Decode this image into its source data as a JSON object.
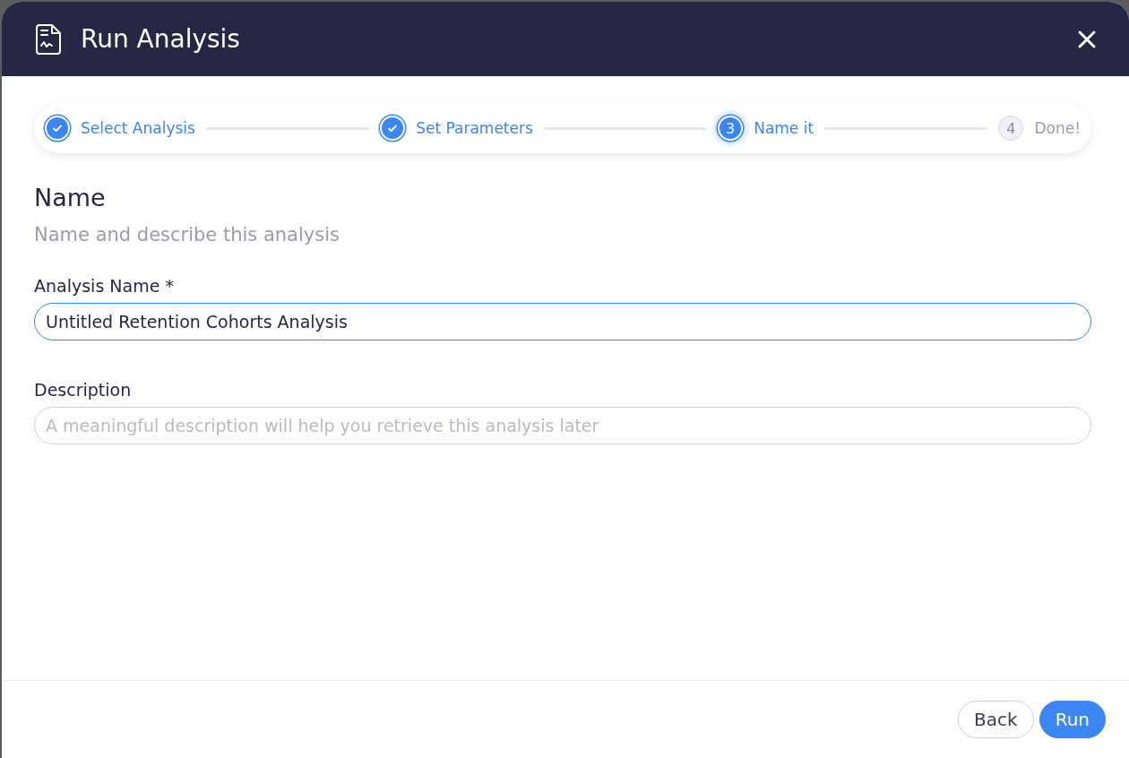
{
  "dialog": {
    "title": "Run Analysis"
  },
  "steps": [
    {
      "label": "Select Analysis",
      "done": true,
      "selected": false
    },
    {
      "label": "Set Parameters",
      "done": true,
      "selected": false
    },
    {
      "label": "Name it",
      "number": "3",
      "done": false,
      "selected": true
    },
    {
      "label": "Done!",
      "number": "4",
      "done": false,
      "selected": false
    }
  ],
  "section": {
    "heading": "Name",
    "subtitle": "Name and describe this analysis"
  },
  "fields": [
    {
      "label": "Analysis Name *",
      "value": "Untitled Retention Cohorts Analysis",
      "focused": true
    },
    {
      "label": "Description",
      "placeholder": "A meaningful description will help you retrieve this analysis later",
      "focused": false
    }
  ],
  "buttons": [
    {
      "label": "Back",
      "kind": "secondary"
    },
    {
      "label": "Run",
      "kind": "primary"
    }
  ]
}
